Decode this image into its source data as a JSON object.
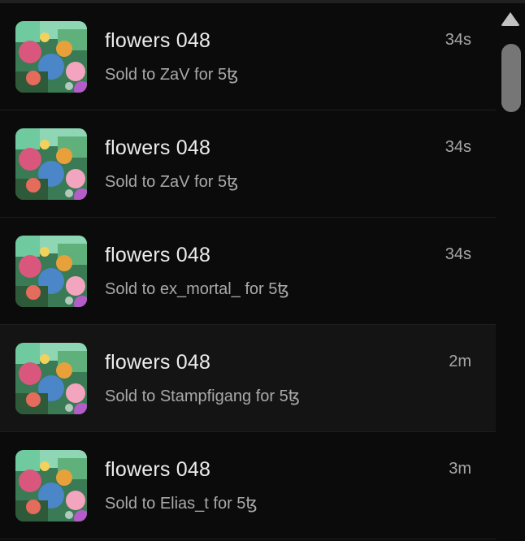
{
  "activity": {
    "items": [
      {
        "title": "flowers 048",
        "detail": "Sold to ZaV for 5ꜩ",
        "time": "34s"
      },
      {
        "title": "flowers 048",
        "detail": "Sold to ZaV for 5ꜩ",
        "time": "34s"
      },
      {
        "title": "flowers 048",
        "detail": "Sold to ex_mortal_ for 5ꜩ",
        "time": "34s"
      },
      {
        "title": "flowers 048",
        "detail": "Sold to Stampfigang for 5ꜩ",
        "time": "2m"
      },
      {
        "title": "flowers 048",
        "detail": "Sold to Elias_t for 5ꜩ",
        "time": "3m"
      }
    ]
  },
  "scrollbar": {
    "up_icon": "triangle-up-icon"
  },
  "colors": {
    "background": "#0b0b0b",
    "row_hover": "#141414",
    "title_text": "#ececec",
    "detail_text": "#a9a9a9",
    "scroll_thumb": "#767676"
  }
}
